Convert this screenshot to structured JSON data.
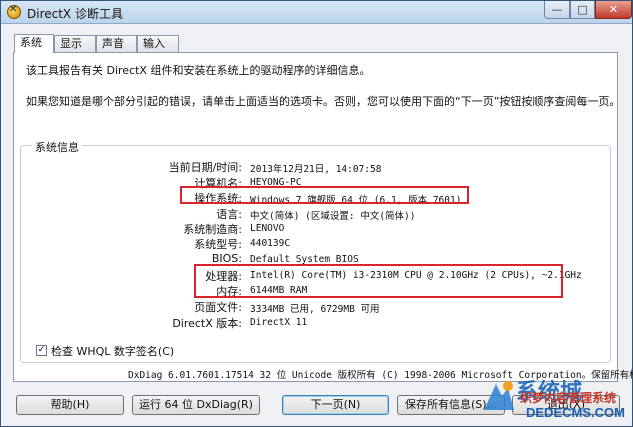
{
  "window": {
    "title": "DirectX 诊断工具"
  },
  "title_controls": {
    "minimize": "—",
    "maximize": "□",
    "close": "✕"
  },
  "tabs": [
    {
      "label": "系统"
    },
    {
      "label": "显示"
    },
    {
      "label": "声音"
    },
    {
      "label": "输入"
    }
  ],
  "intro": {
    "line1": "该工具报告有关 DirectX 组件和安装在系统上的驱动程序的详细信息。",
    "line2": "如果您知道是哪个部分引起的错误，请单击上面适当的选项卡。否则，您可以使用下面的“下一页”按钮按顺序查阅每一页。"
  },
  "system_info": {
    "group_label": "系统信息",
    "rows": [
      {
        "label": "当前日期/时间:",
        "value": "2013年12月21日, 14:07:58"
      },
      {
        "label": "计算机名:",
        "value": "HEYONG-PC"
      },
      {
        "label": "操作系统:",
        "value": "Windows 7 旗舰版 64 位 (6.1, 版本 7601)"
      },
      {
        "label": "语言:",
        "value": "中文(简体) (区域设置: 中文(简体))"
      },
      {
        "label": "系统制造商:",
        "value": "LENOVO"
      },
      {
        "label": "系统型号:",
        "value": "440139C"
      },
      {
        "label": "BIOS:",
        "value": "Default System BIOS"
      },
      {
        "label": "处理器:",
        "value": "Intel(R) Core(TM) i3-2310M CPU @ 2.10GHz (2 CPUs), ~2.1GHz"
      },
      {
        "label": "内存:",
        "value": "6144MB RAM"
      },
      {
        "label": "页面文件:",
        "value": "3334MB 已用, 6729MB 可用"
      },
      {
        "label": "DirectX 版本:",
        "value": "DirectX 11"
      }
    ]
  },
  "whql": {
    "label": "检查 WHQL 数字签名(C)",
    "checked": true,
    "mark": "✓"
  },
  "copyright": "DxDiag 6.01.7601.17514 32 位 Unicode 版权所有 (C) 1998-2006 Microsoft Corporation。保留所有权",
  "buttons": {
    "help": "帮助(H)",
    "run64": "运行 64 位 DxDiag(R)",
    "next": "下一页(N)",
    "save": "保存所有信息(S)...",
    "exit": "退出(X)"
  },
  "watermark": {
    "logo": "系统城",
    "tagline": "织梦内容管理系统",
    "url": "DEDECMS.COM"
  },
  "colors": {
    "highlight": "#d9242b",
    "titlebar": "#bcd3ea",
    "panel_bg": "#ffffff"
  }
}
